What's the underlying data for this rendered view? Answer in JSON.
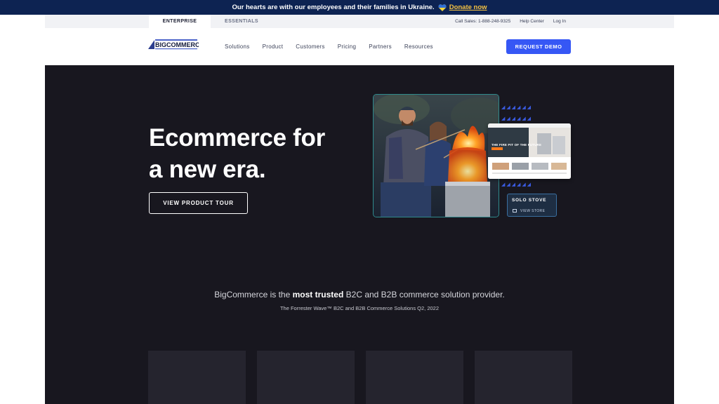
{
  "banner": {
    "message": "Our hearts are with our employees and their families in Ukraine.",
    "donate": "Donate now"
  },
  "utility": {
    "tabs": [
      "ENTERPRISE",
      "ESSENTIALS"
    ],
    "links": [
      "Call Sales: 1-888-248-9325",
      "Help Center",
      "Log In"
    ]
  },
  "nav": {
    "logo_text": "BIGCOMMERCE",
    "items": [
      "Solutions",
      "Product",
      "Customers",
      "Pricing",
      "Partners",
      "Resources"
    ],
    "cta": "REQUEST DEMO"
  },
  "hero": {
    "headline_line1": "Ecommerce for",
    "headline_line2": "a new era.",
    "tour_button": "VIEW PRODUCT TOUR",
    "store_banner": "THE FIRE PIT OF THE FUTURE",
    "badge_title": "SOLO STOVE",
    "badge_link": "VIEW STORE"
  },
  "trust": {
    "prefix": "BigCommerce is the",
    "emphasis": "most trusted",
    "suffix": "B2C and B2B commerce solution provider.",
    "source": "The Forrester Wave™ B2C and B2B Commerce Solutions Q2, 2022"
  },
  "colors": {
    "navy": "#0d2352",
    "accent": "#3657f5",
    "hero_bg": "#18171f",
    "donate": "#f5c242"
  }
}
